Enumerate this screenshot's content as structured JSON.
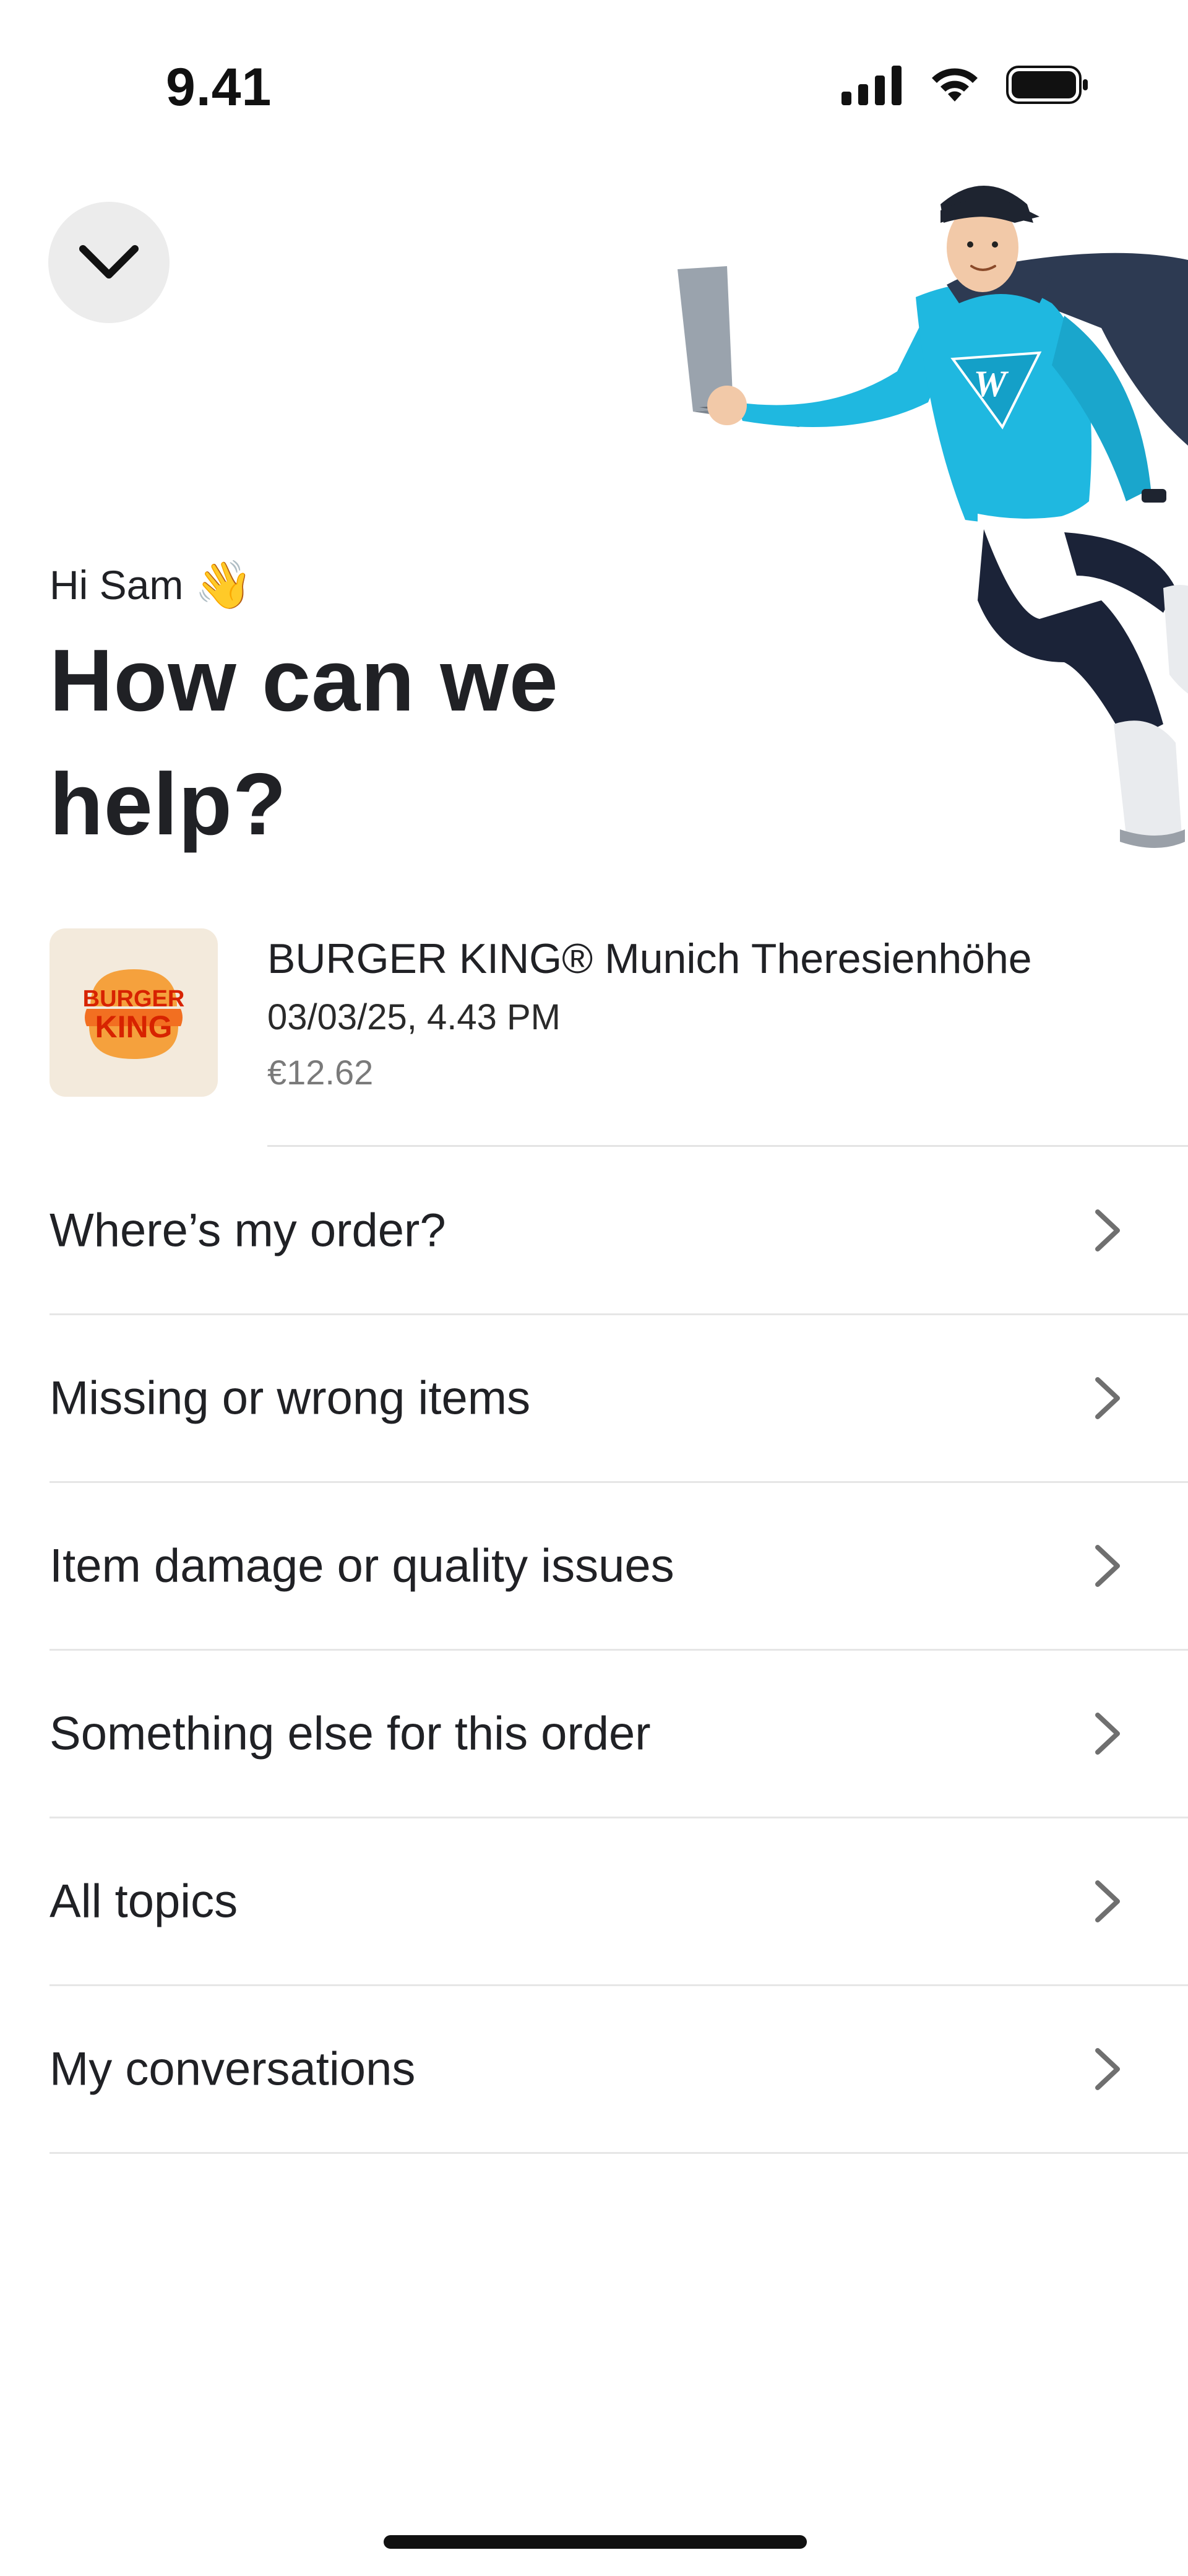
{
  "status_bar": {
    "time": "9.41",
    "icons": [
      "cellular-signal-icon",
      "wifi-icon",
      "battery-icon"
    ]
  },
  "header": {
    "collapse_icon": "chevron-down-icon",
    "greeting": "Hi Sam",
    "greeting_emoji": "👋",
    "headline": "How can we help?",
    "illustration": "mascot-with-laptop"
  },
  "order": {
    "logo_text_line1": "BURGER",
    "logo_text_line2": "KING",
    "title": "BURGER KING® Munich Theresienhöhe",
    "date": "03/03/25, 4.43 PM",
    "price": "€12.62"
  },
  "menu": {
    "items": [
      {
        "label": "Where’s my order?"
      },
      {
        "label": "Missing or wrong items"
      },
      {
        "label": "Item damage or quality issues"
      },
      {
        "label": "Something else for this order"
      },
      {
        "label": "All topics"
      },
      {
        "label": "My conversations"
      }
    ]
  },
  "colors": {
    "text": "#202125",
    "muted": "#7a7a7a",
    "divider": "#e6e6e6",
    "button_bg": "#ececec",
    "mascot_blue": "#1fb8e0",
    "burger_king_orange": "#f26f21",
    "burger_king_red": "#d72300"
  }
}
